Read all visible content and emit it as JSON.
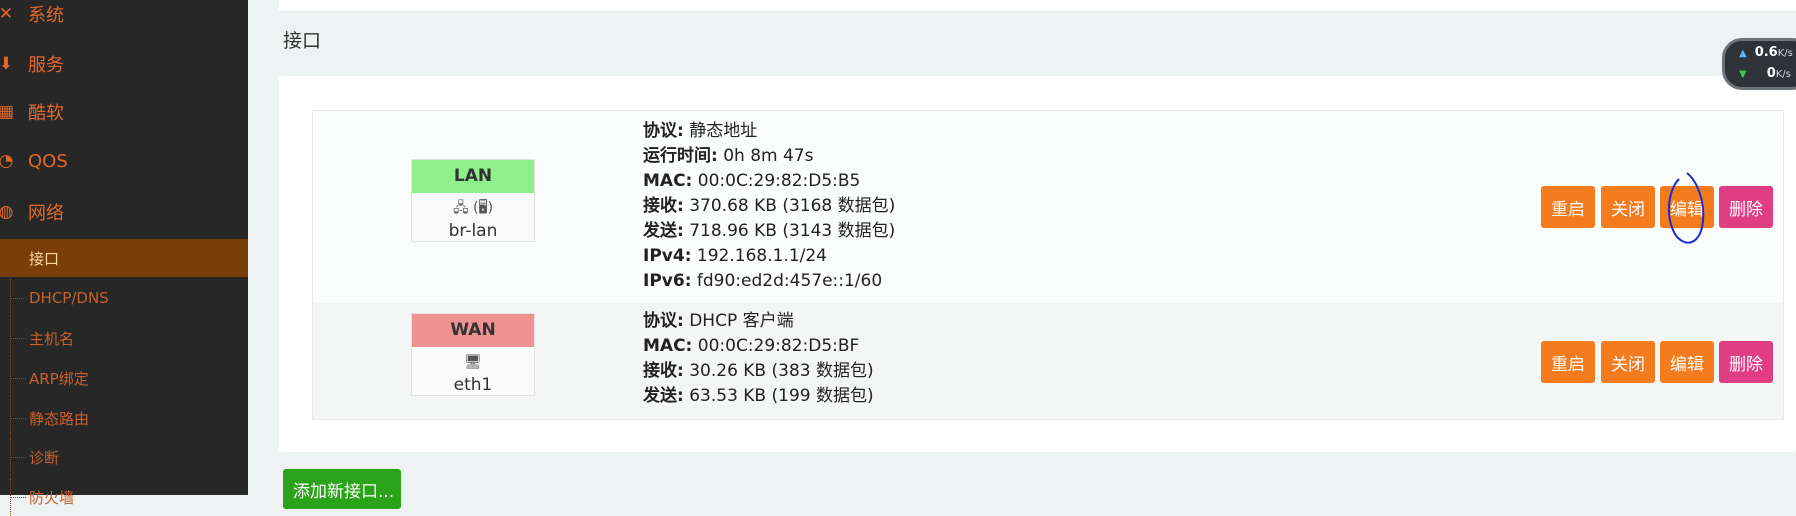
{
  "sidebar": {
    "menu": [
      {
        "label": "系统",
        "icon": "wrench-icon"
      },
      {
        "label": "服务",
        "icon": "download-icon"
      },
      {
        "label": "酷软",
        "icon": "grid-icon"
      },
      {
        "label": "QOS",
        "icon": "gauge-icon"
      },
      {
        "label": "网络",
        "icon": "globe-icon"
      }
    ],
    "submenu": [
      {
        "label": "接口",
        "active": true
      },
      {
        "label": "DHCP/DNS"
      },
      {
        "label": "主机名"
      },
      {
        "label": "ARP绑定"
      },
      {
        "label": "静态路由"
      },
      {
        "label": "诊断"
      },
      {
        "label": "防火墙"
      }
    ]
  },
  "main": {
    "section_title": "接口",
    "interfaces": [
      {
        "name": "LAN",
        "device": "br-lan",
        "icons": "🖧 (🖥)",
        "header_color": "#8ef08a",
        "info": [
          {
            "k": "协议:",
            "v": " 静态地址"
          },
          {
            "k": "运行时间:",
            "v": " 0h 8m 47s"
          },
          {
            "k": "MAC:",
            "v": " 00:0C:29:82:D5:B5"
          },
          {
            "k": "接收:",
            "v": " 370.68 KB (3168 数据包)"
          },
          {
            "k": "发送:",
            "v": " 718.96 KB (3143 数据包)"
          },
          {
            "k": "IPv4:",
            "v": " 192.168.1.1/24"
          },
          {
            "k": "IPv6:",
            "v": " fd90:ed2d:457e::1/60"
          }
        ]
      },
      {
        "name": "WAN",
        "device": "eth1",
        "icons": "🖥",
        "header_color": "#f09292",
        "info": [
          {
            "k": "协议:",
            "v": " DHCP 客户端"
          },
          {
            "k": "MAC:",
            "v": " 00:0C:29:82:D5:BF"
          },
          {
            "k": "接收:",
            "v": " 30.26 KB (383 数据包)"
          },
          {
            "k": "发送:",
            "v": " 63.53 KB (199 数据包)"
          }
        ]
      }
    ],
    "buttons": {
      "restart": "重启",
      "stop": "关闭",
      "edit": "编辑",
      "delete": "删除"
    },
    "add_button": "添加新接口..."
  },
  "speed": {
    "up": "0.6",
    "down": "0",
    "unit": "K/s"
  },
  "colors": {
    "accent": "#f47b1e",
    "danger": "#df3d84",
    "success": "#2aa21a",
    "sidebar": "#272727"
  }
}
